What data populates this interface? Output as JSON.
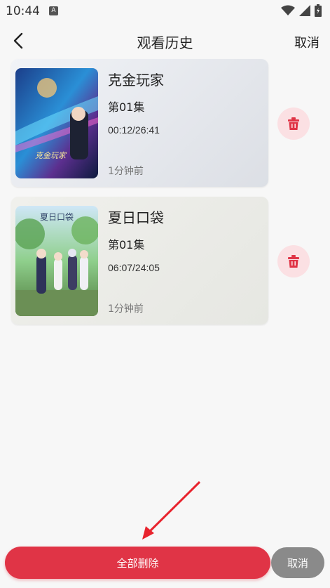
{
  "status_bar": {
    "time": "10:44",
    "notification": "A"
  },
  "header": {
    "title": "观看历史",
    "cancel_label": "取消"
  },
  "history": [
    {
      "title": "克金玩家",
      "episode": "第01集",
      "progress": "00:12/26:41",
      "time_ago": "1分钟前",
      "cover_text": "克金玩家"
    },
    {
      "title": "夏日口袋",
      "episode": "第01集",
      "progress": "06:07/24:05",
      "time_ago": "1分钟前",
      "cover_text": "夏日口袋"
    }
  ],
  "bottom": {
    "delete_all_label": "全部删除",
    "cancel_label": "取消"
  },
  "colors": {
    "accent": "#e03446",
    "delete_bg": "#fbe0e3",
    "cancel_gray": "#8a8a8a"
  },
  "icons": [
    "back-arrow-icon",
    "trash-icon",
    "wifi-icon",
    "signal-icon",
    "battery-icon"
  ]
}
